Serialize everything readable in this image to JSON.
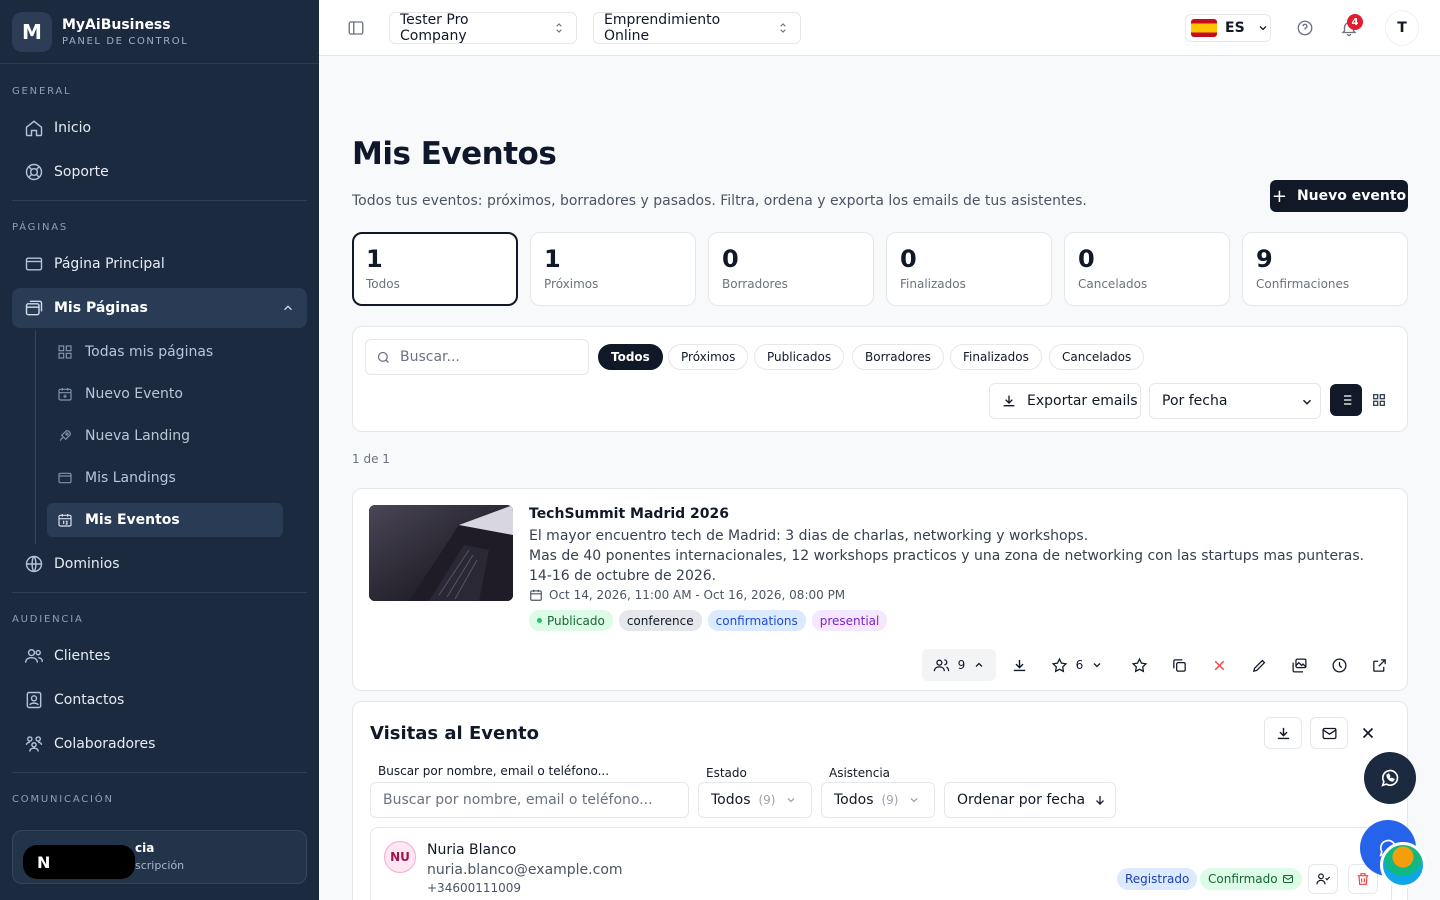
{
  "app": {
    "name_prefix": "MyAi",
    "name_suffix": "Business",
    "subtitle": "PANEL DE CONTROL",
    "logo_letter": "M"
  },
  "sidebar": {
    "sections": {
      "general": "GENERAL",
      "paginas": "PÁGINAS",
      "audiencia": "AUDIENCIA",
      "comunicacion": "COMUNICACIÓN"
    },
    "general": [
      {
        "label": "Inicio",
        "icon": "home-icon"
      },
      {
        "label": "Soporte",
        "icon": "lifebuoy-icon"
      }
    ],
    "paginas": [
      {
        "label": "Página Principal",
        "icon": "window-icon"
      },
      {
        "label": "Mis Páginas",
        "icon": "windows-icon",
        "expanded": true
      }
    ],
    "mis_paginas_sub": [
      {
        "label": "Todas mis páginas",
        "icon": "grid-icon"
      },
      {
        "label": "Nuevo Evento",
        "icon": "calendar-plus-icon"
      },
      {
        "label": "Nueva Landing",
        "icon": "rocket-icon"
      },
      {
        "label": "Mis Landings",
        "icon": "window-icon"
      },
      {
        "label": "Mis Eventos",
        "icon": "calendar-icon",
        "active": true
      }
    ],
    "dominios": {
      "label": "Dominios",
      "icon": "globe-icon"
    },
    "audiencia": [
      {
        "label": "Clientes",
        "icon": "users-icon"
      },
      {
        "label": "Contactos",
        "icon": "contact-book-icon"
      },
      {
        "label": "Colaboradores",
        "icon": "team-icon"
      }
    ],
    "user": {
      "initial": "N",
      "name_fragment": "cia",
      "sub_fragment": "scripción"
    }
  },
  "topbar": {
    "company": "Tester Pro Company",
    "project": "Emprendimiento Online",
    "language": "ES",
    "notifications": "4",
    "avatar": "T"
  },
  "page": {
    "title": "Mis Eventos",
    "subtitle": "Todos tus eventos: próximos, borradores y pasados. Filtra, ordena y exporta los emails de tus asistentes.",
    "new_button": "Nuevo evento"
  },
  "stats": [
    {
      "value": "1",
      "label": "Todos",
      "selected": true
    },
    {
      "value": "1",
      "label": "Próximos"
    },
    {
      "value": "0",
      "label": "Borradores"
    },
    {
      "value": "0",
      "label": "Finalizados"
    },
    {
      "value": "0",
      "label": "Cancelados"
    },
    {
      "value": "9",
      "label": "Confirmaciones"
    }
  ],
  "filters": {
    "search_placeholder": "Buscar...",
    "pills": [
      "Todos",
      "Próximos",
      "Publicados",
      "Borradores",
      "Finalizados",
      "Cancelados"
    ],
    "active_pill": "Todos",
    "export_label": "Exportar emails",
    "sort_value": "Por fecha"
  },
  "pager": "1 de 1",
  "event": {
    "title": "TechSummit Madrid 2026",
    "short_desc": "El mayor encuentro tech de Madrid: 3 dias de charlas, networking y workshops.",
    "long_desc": "Mas de 40 ponentes internacionales, 12 workshops practicos y una zona de networking con las startups mas punteras. 14-16 de octubre de 2026.",
    "date": "Oct 14, 2026, 11:00 AM - Oct 16, 2026, 08:00 PM",
    "tags": {
      "status": "Publicado",
      "type": "conference",
      "mode": "confirmations",
      "format": "presential"
    },
    "attendees_count": "9",
    "rating_count": "6"
  },
  "visits": {
    "title": "Visitas al Evento",
    "search_label": "Buscar por nombre, email o teléfono...",
    "search_placeholder": "Buscar por nombre, email o teléfono...",
    "estado_label": "Estado",
    "estado_value": "Todos",
    "estado_count": "(9)",
    "asistencia_label": "Asistencia",
    "asistencia_value": "Todos",
    "asistencia_count": "(9)",
    "order_label": "Ordenar por fecha",
    "person": {
      "initials": "NU",
      "name": "Nuria Blanco",
      "email": "nuria.blanco@example.com",
      "phone": "+34600111009",
      "tag_registered": "Registrado",
      "tag_confirmed": "Confirmado"
    }
  },
  "colors": {
    "sidebar_bg": "#1b2a3e",
    "primary": "#111827",
    "whatsapp_fab": "#1b2a3e",
    "chat_fab": "#2563eb",
    "danger": "#ef4444"
  }
}
